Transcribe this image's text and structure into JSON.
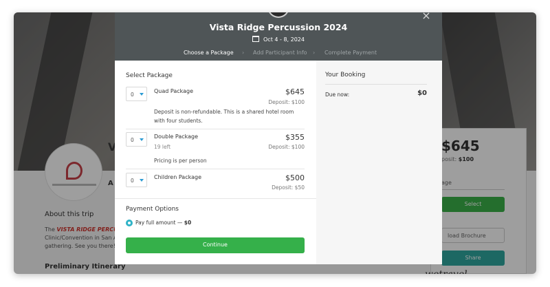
{
  "background": {
    "profile_letter": "V",
    "sub_letter": "A",
    "about_title": "About this trip",
    "about_line1_prefix": "The ",
    "about_line1_bold": "VISTA RIDGE PERCUSSI",
    "about_line2": "Clinic/Convention in San A",
    "about_line3": "gathering.  See you there!",
    "itinerary_title": "Preliminary Itinerary",
    "card_price": "$645",
    "card_deposit_label": "posit:",
    "card_deposit_value": "$100",
    "card_select_text": "age",
    "card_select_button": "Select",
    "card_download": "load Brochure",
    "card_share": "Share",
    "brand": "wetravel"
  },
  "modal": {
    "title": "Vista Ridge Percussion 2024",
    "dates": "Oct 4 - 8, 2024",
    "close_glyph": "×",
    "steps": [
      {
        "label": "Choose a Package"
      },
      {
        "label": "Add Participant Info"
      },
      {
        "label": "Complete Payment"
      }
    ],
    "step_separator": "›"
  },
  "select_package": {
    "title": "Select Package",
    "packages": [
      {
        "qty": "0",
        "name": "Quad Package",
        "price": "$645",
        "deposit": "Deposit: $100",
        "left": "",
        "description": "Deposit is non-refundable. This is a shared hotel room with four students."
      },
      {
        "qty": "0",
        "name": "Double Package",
        "price": "$355",
        "deposit": "Deposit: $100",
        "left": "19 left",
        "description": "Pricing is per person"
      },
      {
        "qty": "0",
        "name": "Children Package",
        "price": "$500",
        "deposit": "Deposit: $50",
        "left": "",
        "description": ""
      }
    ]
  },
  "payment": {
    "title": "Payment Options",
    "option_label": "Pay full amount — ",
    "option_amount": "$0",
    "continue_label": "Continue"
  },
  "booking": {
    "title": "Your Booking",
    "due_label": "Due now:",
    "due_value": "$0"
  },
  "colors": {
    "header_bg": "#4f5557",
    "continue_green": "#35b04a",
    "radio_teal": "#2fb3c7",
    "caret_blue": "#2b9bd3"
  }
}
